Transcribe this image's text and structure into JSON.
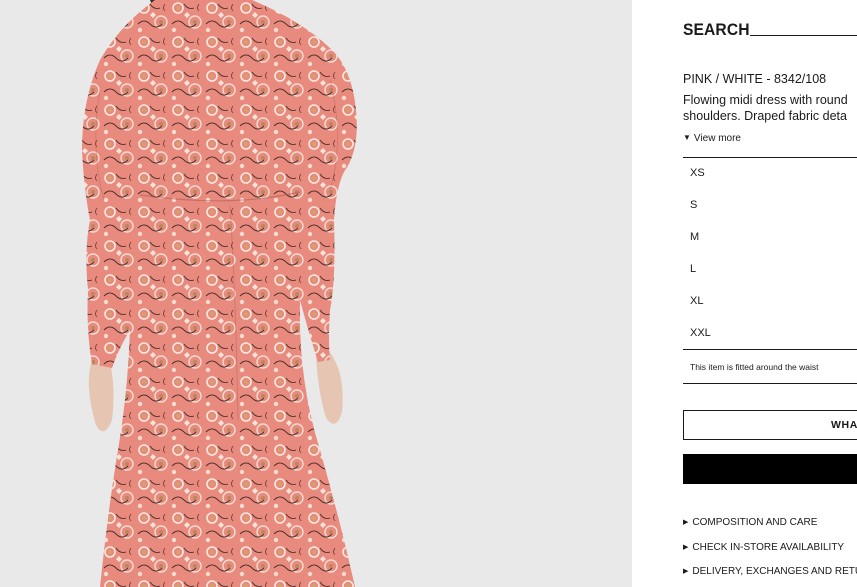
{
  "header": {
    "search_label": "SEARCH"
  },
  "product": {
    "color_ref": "PINK / WHITE - 8342/108",
    "description_line1": "Flowing midi dress with round",
    "description_line2": "shoulders. Draped fabric deta",
    "view_more": "View more"
  },
  "sizes": [
    {
      "label": "XS"
    },
    {
      "label": "S"
    },
    {
      "label": "M"
    },
    {
      "label": "L"
    },
    {
      "label": "XL"
    },
    {
      "label": "XXL"
    }
  ],
  "fit_note": "This item is fitted around the waist",
  "buttons": {
    "what_label": "WHA",
    "add_label": ""
  },
  "links": [
    {
      "label": "COMPOSITION AND CARE"
    },
    {
      "label": "CHECK IN-STORE AVAILABILITY"
    },
    {
      "label": "DELIVERY, EXCHANGES AND RETUR"
    }
  ],
  "colors": {
    "dress": "#e8847a",
    "background": "#e9e9e9",
    "text": "#1a1a1a"
  }
}
